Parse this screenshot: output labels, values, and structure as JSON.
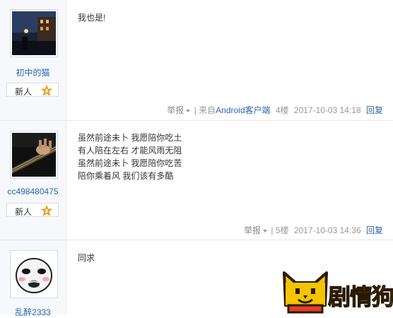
{
  "posts": [
    {
      "username": "初中的猫",
      "level": "新人",
      "lines": [
        "我也是!"
      ],
      "report": "举报",
      "meta_sep": "|",
      "source": "来自",
      "client": "Android客户端",
      "floor": "4楼",
      "time": "2017-10-03 14:18",
      "reply": "回复"
    },
    {
      "username": "cc498480475",
      "level": "新人",
      "lines": [
        "虽然前途未卜 我愿陪你吃土",
        "有人陪在左右 才能风雨无阻",
        "虽然前途未卜 我愿陪你吃苦",
        "陪你乘着风 我们该有多酷"
      ],
      "report": "举报",
      "meta_sep": "|",
      "floor": "5楼",
      "time": "2017-10-03 14:36",
      "reply": "回复"
    },
    {
      "username": "乱醉2333",
      "lines": [
        "同求"
      ]
    }
  ],
  "watermark": {
    "text": "剧情狗"
  },
  "colors": {
    "link": "#2d64b3",
    "meta": "#999999",
    "star": "#f3b22b",
    "logo": "#f4c400"
  },
  "icons": [
    "level-star-icon",
    "dropdown-arrow-icon",
    "cat-logo-icon"
  ]
}
